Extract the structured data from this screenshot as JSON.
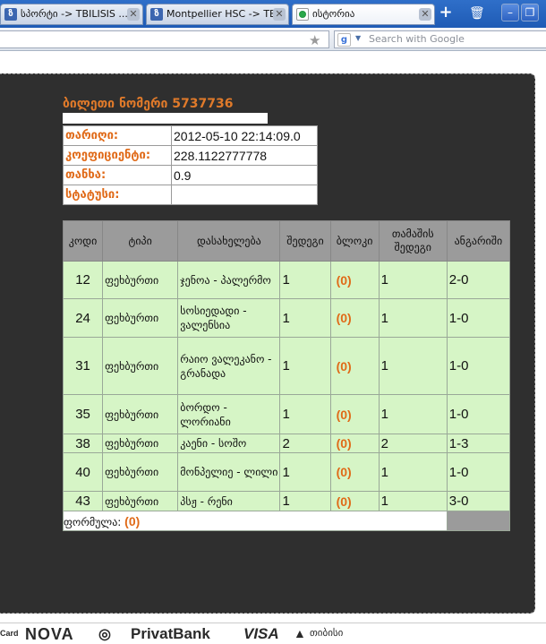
{
  "browser": {
    "tabs": [
      {
        "label": "სპორტი -> TBILISIS ...",
        "active": false
      },
      {
        "label": "Montpellier HSC -> TB...",
        "active": false
      },
      {
        "label": "ისტორია",
        "active": true
      }
    ],
    "search_placeholder": "Search with Google"
  },
  "ticket": {
    "title": "ბილეთი ნომერი 5737736",
    "fields": [
      {
        "label": "თარიღი:",
        "value": "2012-05-10 22:14:09.0"
      },
      {
        "label": "კოეფიციენტი:",
        "value": "228.1122777778"
      },
      {
        "label": "თანხა:",
        "value": "0.9"
      },
      {
        "label": "სტატუსი:",
        "value": ""
      }
    ]
  },
  "bets_table": {
    "headers": [
      "კოდი",
      "ტიპი",
      "დასახელება",
      "შედეგი",
      "ბლოკი",
      "თამაშის შედეგი",
      "ანგარიში"
    ],
    "rows": [
      {
        "code": "12",
        "type": "ფეხბურთი",
        "name": "ჯენოა - პალერმო",
        "result": "1",
        "block": "(0)",
        "game_result": "1",
        "score": "2-0"
      },
      {
        "code": "24",
        "type": "ფეხბურთი",
        "name": "სოსიედადი - ვალენსია",
        "result": "1",
        "block": "(0)",
        "game_result": "1",
        "score": "1-0"
      },
      {
        "code": "31",
        "type": "ფეხბურთი",
        "name": "რაიო ვალეკანო - გრანადა",
        "result": "1",
        "block": "(0)",
        "game_result": "1",
        "score": "1-0"
      },
      {
        "code": "35",
        "type": "ფეხბურთი",
        "name": "ბორდო - ლორიანი",
        "result": "1",
        "block": "(0)",
        "game_result": "1",
        "score": "1-0"
      },
      {
        "code": "38",
        "type": "ფეხბურთი",
        "name": "კაენი - სოშო",
        "result": "2",
        "block": "(0)",
        "game_result": "2",
        "score": "1-3"
      },
      {
        "code": "40",
        "type": "ფეხბურთი",
        "name": "მონპელიე - ლილი",
        "result": "1",
        "block": "(0)",
        "game_result": "1",
        "score": "1-0"
      },
      {
        "code": "43",
        "type": "ფეხბურთი",
        "name": "პსჟ - რენი",
        "result": "1",
        "block": "(0)",
        "game_result": "1",
        "score": "3-0"
      }
    ],
    "formula_label": "ფორმულა:",
    "formula_value": "(0)"
  },
  "logos": [
    "Card",
    "NOVA",
    "PrivatBank",
    "VISA",
    "თიბისი"
  ],
  "colors": {
    "accent": "#e06a18",
    "panel": "#2f2f2f",
    "row_bg": "#d6f5c6",
    "header_bg": "#9b9b9b"
  }
}
